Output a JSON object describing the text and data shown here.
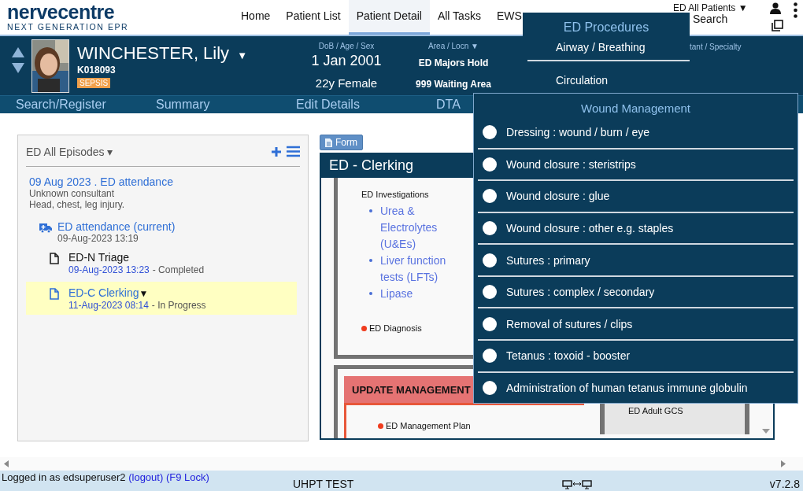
{
  "logo": {
    "name": "nervecentre",
    "tagline": "NEXT GENERATION EPR"
  },
  "nav": [
    {
      "label": "Home",
      "selected": false
    },
    {
      "label": "Patient List",
      "selected": false
    },
    {
      "label": "Patient Detail",
      "selected": true
    },
    {
      "label": "All Tasks",
      "selected": false
    },
    {
      "label": "EWS",
      "selected": false
    }
  ],
  "header_right": {
    "patient_list": "ED All Patients ▼",
    "search": "Search"
  },
  "patient": {
    "name": "WINCHESTER, Lily",
    "caret": "▼",
    "mrn": "K018093",
    "alert": "SEPSIS",
    "fields": [
      {
        "label": "DoB / Age / Sex",
        "lines": [
          "1 Jan 2001",
          "22y Female"
        ],
        "kind": "demographics"
      },
      {
        "label": "Area / Locn  ▼",
        "lines": [
          "ED Majors Hold",
          "999 Waiting Area"
        ],
        "kind": "location"
      }
    ],
    "partial_label": "tant / Specialty"
  },
  "subnav": [
    "Search/Register",
    "Summary",
    "Edit Details",
    "DTA"
  ],
  "episodes": {
    "heading": "ED All Episodes ▾",
    "items": [
      {
        "title": "09 Aug 2023 . ED attendance",
        "lines": [
          "Unknown consultant",
          "Head, chest, leg injury."
        ],
        "children": [
          {
            "title": "ED attendance (current)",
            "date": "09-Aug-2023 13:19",
            "children": [
              {
                "title": "ED-N Triage",
                "date": "09-Aug-2023 13:23",
                "status": "- Completed",
                "selected": false
              },
              {
                "title": "ED-C Clerking",
                "caret": "▼",
                "date": "11-Aug-2023 08:14",
                "status": "- In Progress",
                "selected": true
              }
            ]
          }
        ]
      }
    ]
  },
  "form": {
    "button": "Form",
    "title": "ED - Clerking",
    "section_heading": "ED Investigations",
    "investigations": [
      "Urea & Electrolytes (U&Es)",
      "Liver function tests (LFTs)",
      "Lipase"
    ],
    "diagnosis": "ED Diagnosis",
    "management_heading": "UPDATE MANAGEMENT",
    "management_item": "ED Management Plan",
    "side_item": "ED Adult GCS"
  },
  "menus": {
    "ed_procedures": {
      "title": "ED Procedures",
      "items": [
        "Airway / Breathing",
        "Circulation"
      ]
    },
    "wound_management": {
      "title": "Wound Management",
      "items": [
        {
          "label": "Dressing : wound / burn / eye",
          "selected": false
        },
        {
          "label": "Wound closure : steristrips",
          "selected": false
        },
        {
          "label": "Wound closure : glue",
          "selected": false
        },
        {
          "label": "Wound closure : other e.g. staples",
          "selected": false
        },
        {
          "label": "Sutures : primary",
          "selected": false
        },
        {
          "label": "Sutures : complex / secondary",
          "selected": false
        },
        {
          "label": "Removal of sutures / clips",
          "selected": false
        },
        {
          "label": "Tetanus : toxoid - booster",
          "selected": false
        },
        {
          "label": "Administration of human tetanus immune globulin",
          "selected": false
        }
      ]
    }
  },
  "status_bar": {
    "login_text": "Logged in as edsuperuser2",
    "logout": "(logout)",
    "lock": "(F9 Lock)",
    "site": "UHPT TEST",
    "version": "v7.2.8"
  }
}
